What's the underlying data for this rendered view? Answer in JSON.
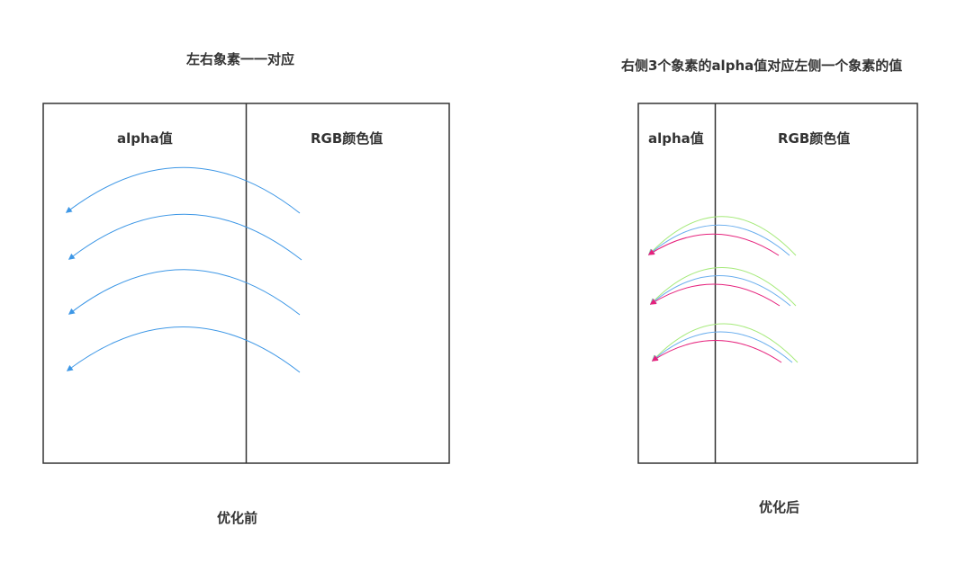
{
  "before": {
    "title": "左右象素一一对应",
    "alpha_label": "alpha值",
    "rgb_label": "RGB颜色值",
    "caption": "优化前",
    "arrow_color": "#3d97e6"
  },
  "after": {
    "title": "右侧3个象素的alpha值对应左侧一个象素的值",
    "alpha_label": "alpha值",
    "rgb_label": "RGB颜色值",
    "caption": "优化后",
    "arrow_colors": [
      "#a6ea7b",
      "#6aaeee",
      "#e6217c"
    ]
  },
  "colors": {
    "border": "#333333",
    "text": "#333333",
    "background": "#ffffff"
  }
}
